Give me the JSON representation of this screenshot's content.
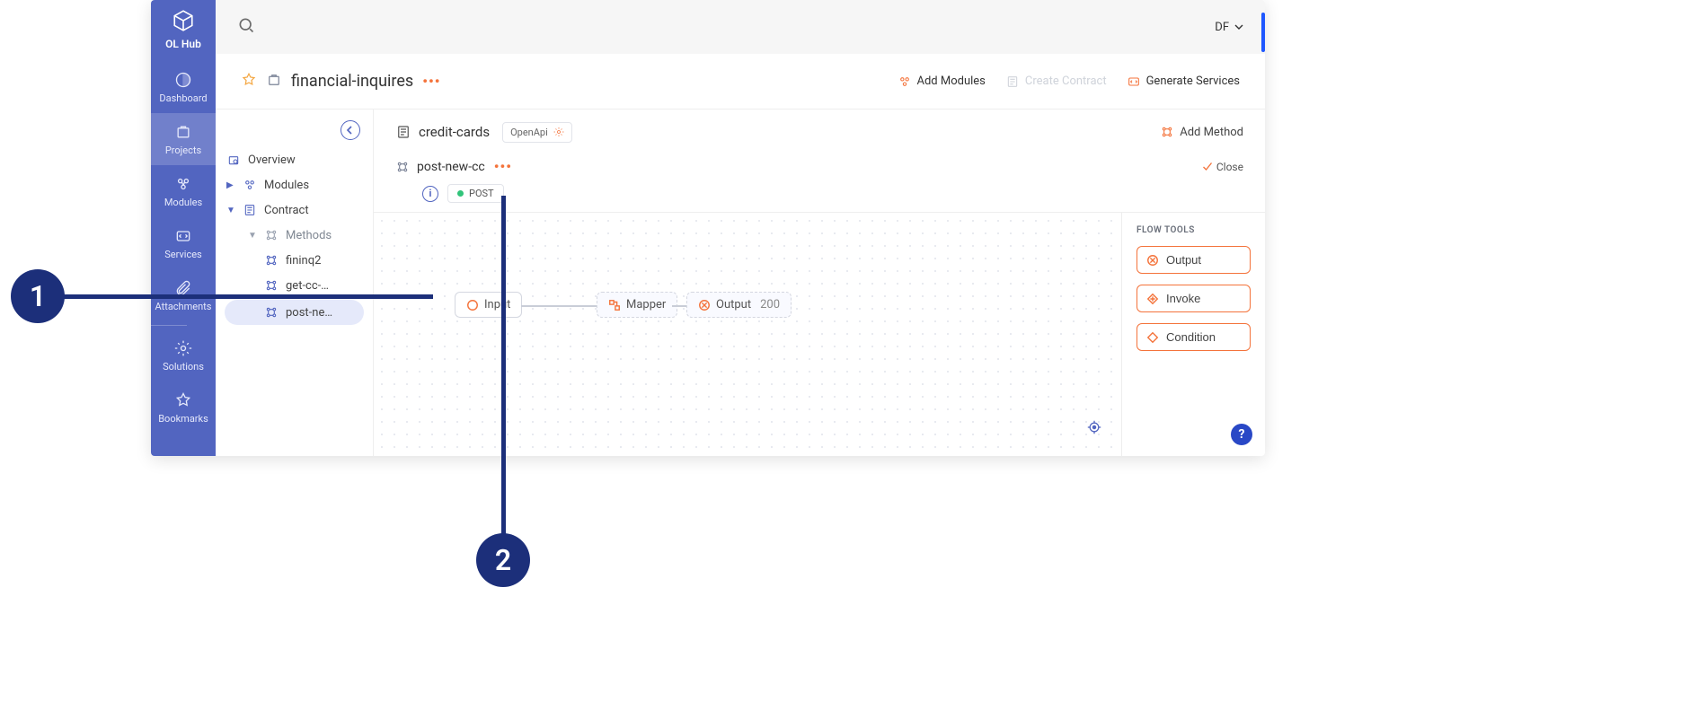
{
  "brand": {
    "name": "OL Hub"
  },
  "sidebar": {
    "items": [
      {
        "label": "Dashboard"
      },
      {
        "label": "Projects"
      },
      {
        "label": "Modules"
      },
      {
        "label": "Services"
      },
      {
        "label": "Attachments"
      },
      {
        "label": "Solutions"
      },
      {
        "label": "Bookmarks"
      }
    ]
  },
  "user": {
    "initials": "DF"
  },
  "project": {
    "name": "financial-inquires",
    "actions": {
      "add_modules": "Add Modules",
      "create_contract": "Create Contract",
      "generate_services": "Generate Services"
    }
  },
  "tree": {
    "overview": "Overview",
    "modules": "Modules",
    "contract": "Contract",
    "methods_group": "Methods",
    "methods": [
      {
        "label": "fininq2"
      },
      {
        "label": "get-cc-…"
      },
      {
        "label": "post-ne…"
      }
    ]
  },
  "contract": {
    "name": "credit-cards",
    "openapi": "OpenApi",
    "add_method": "Add Method"
  },
  "method": {
    "name": "post-new-cc",
    "verb": "POST",
    "close": "Close"
  },
  "flow": {
    "input": "Input",
    "mapper": "Mapper",
    "output": "Output",
    "output_code": "200"
  },
  "tools": {
    "title": "FLOW TOOLS",
    "output": "Output",
    "invoke": "Invoke",
    "condition": "Condition"
  },
  "callouts": {
    "one": "1",
    "two": "2"
  }
}
